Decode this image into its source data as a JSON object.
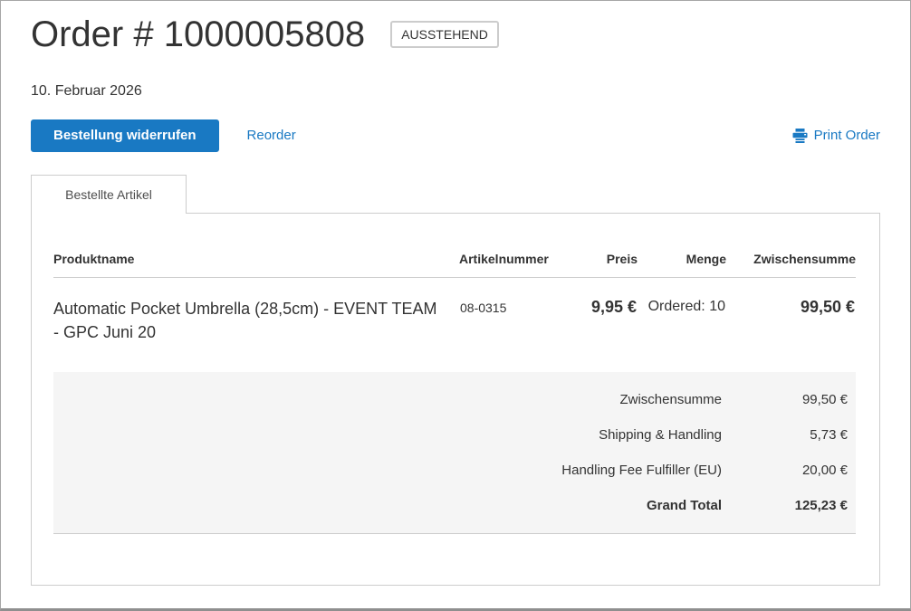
{
  "page": {
    "title": "Order # 1000005808",
    "status_badge": "AUSSTEHEND",
    "order_date": "10. Februar 2026"
  },
  "actions": {
    "cancel_button": "Bestellung widerrufen",
    "reorder_link": "Reorder",
    "print_link": "Print Order",
    "print_icon": "printer-icon"
  },
  "tabs": [
    {
      "label": "Bestellte Artikel",
      "active": true
    }
  ],
  "items_table": {
    "columns": [
      "Produktname",
      "Artikelnummer",
      "Preis",
      "Menge",
      "Zwischensumme"
    ],
    "rows": [
      {
        "product_name": "Automatic Pocket Umbrella (28,5cm) - EVENT TEAM - GPC Juni 20",
        "sku": "08-0315",
        "price": "9,95 €",
        "qty": "Ordered: 10",
        "subtotal": "99,50 €"
      }
    ]
  },
  "totals": {
    "rows": [
      {
        "label": "Zwischensumme",
        "value": "99,50 €"
      },
      {
        "label": "Shipping & Handling",
        "value": "5,73 €"
      },
      {
        "label": "Handling Fee Fulfiller (EU)",
        "value": "20,00 €"
      },
      {
        "label": "Grand Total",
        "value": "125,23 €",
        "bold": true
      }
    ]
  },
  "colors": {
    "accent": "#1979c3",
    "totals_background": "#f5f5f5",
    "border": "#cccccc",
    "text": "#333333"
  }
}
